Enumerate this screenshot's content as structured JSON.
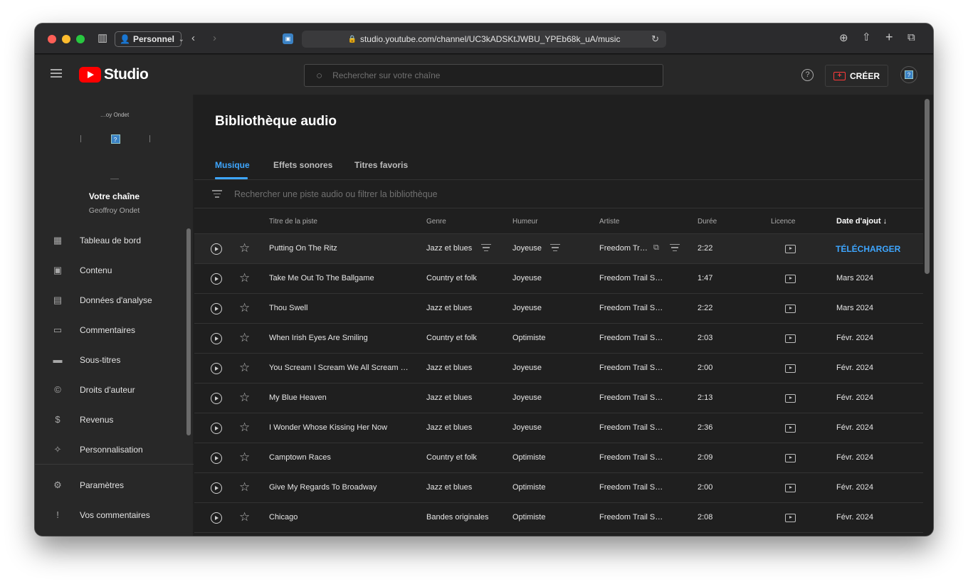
{
  "browser": {
    "profile_label": "Personnel",
    "url": "studio.youtube.com/channel/UC3kADSKtJWBU_YPEb68k_uA/music"
  },
  "header": {
    "logo_text": "Studio",
    "search_placeholder": "Rechercher sur votre chaîne",
    "create_label": "CRÉER"
  },
  "sidebar": {
    "channel_tiny": "…oy Ondet",
    "channel_title": "Votre chaîne",
    "channel_name": "Geoffroy Ondet",
    "items": [
      {
        "label": "Tableau de bord",
        "icon": "dashboard-icon"
      },
      {
        "label": "Contenu",
        "icon": "content-icon"
      },
      {
        "label": "Données d'analyse",
        "icon": "analytics-icon"
      },
      {
        "label": "Commentaires",
        "icon": "comments-icon"
      },
      {
        "label": "Sous-titres",
        "icon": "subtitles-icon"
      },
      {
        "label": "Droits d'auteur",
        "icon": "copyright-icon"
      },
      {
        "label": "Revenus",
        "icon": "dollar-icon"
      },
      {
        "label": "Personnalisation",
        "icon": "magic-wand-icon"
      }
    ],
    "bottom_items": [
      {
        "label": "Paramètres",
        "icon": "gear-icon"
      },
      {
        "label": "Vos commentaires",
        "icon": "feedback-icon"
      }
    ]
  },
  "page": {
    "title": "Bibliothèque audio",
    "tabs": [
      "Musique",
      "Effets sonores",
      "Titres favoris"
    ],
    "active_tab": "Musique",
    "filter_placeholder": "Rechercher une piste audio ou filtrer la bibliothèque"
  },
  "table": {
    "columns": [
      "Titre de la piste",
      "Genre",
      "Humeur",
      "Artiste",
      "Durée",
      "Licence",
      "Date d'ajout ↓"
    ],
    "download_label": "TÉLÉCHARGER",
    "rows": [
      {
        "title": "Putting On The Ritz",
        "genre": "Jazz et blues",
        "mood": "Joyeuse",
        "artist": "Freedom Tr…",
        "duration": "2:22",
        "date": ""
      },
      {
        "title": "Take Me Out To The Ballgame",
        "genre": "Country et folk",
        "mood": "Joyeuse",
        "artist": "Freedom Trail S…",
        "duration": "1:47",
        "date": "Mars 2024"
      },
      {
        "title": "Thou Swell",
        "genre": "Jazz et blues",
        "mood": "Joyeuse",
        "artist": "Freedom Trail S…",
        "duration": "2:22",
        "date": "Mars 2024"
      },
      {
        "title": "When Irish Eyes Are Smiling",
        "genre": "Country et folk",
        "mood": "Optimiste",
        "artist": "Freedom Trail S…",
        "duration": "2:03",
        "date": "Févr. 2024"
      },
      {
        "title": "You Scream I Scream We All Scream …",
        "genre": "Jazz et blues",
        "mood": "Joyeuse",
        "artist": "Freedom Trail S…",
        "duration": "2:00",
        "date": "Févr. 2024"
      },
      {
        "title": "My Blue Heaven",
        "genre": "Jazz et blues",
        "mood": "Joyeuse",
        "artist": "Freedom Trail S…",
        "duration": "2:13",
        "date": "Févr. 2024"
      },
      {
        "title": "I Wonder Whose Kissing Her Now",
        "genre": "Jazz et blues",
        "mood": "Joyeuse",
        "artist": "Freedom Trail S…",
        "duration": "2:36",
        "date": "Févr. 2024"
      },
      {
        "title": "Camptown Races",
        "genre": "Country et folk",
        "mood": "Optimiste",
        "artist": "Freedom Trail S…",
        "duration": "2:09",
        "date": "Févr. 2024"
      },
      {
        "title": "Give My Regards To Broadway",
        "genre": "Jazz et blues",
        "mood": "Optimiste",
        "artist": "Freedom Trail S…",
        "duration": "2:00",
        "date": "Févr. 2024"
      },
      {
        "title": "Chicago",
        "genre": "Bandes originales",
        "mood": "Optimiste",
        "artist": "Freedom Trail S…",
        "duration": "2:08",
        "date": "Févr. 2024"
      }
    ]
  },
  "colors": {
    "accent": "#3ea6ff",
    "brand_red": "#ff0000",
    "background": "#1f1f1f"
  }
}
